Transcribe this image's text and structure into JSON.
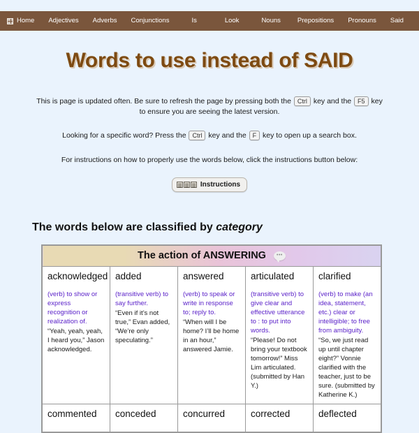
{
  "nav": {
    "items": [
      {
        "label": "Home",
        "icon": "home-icon"
      },
      {
        "label": "Adjectives"
      },
      {
        "label": "Adverbs"
      },
      {
        "label": "Conjunctions"
      },
      {
        "label": "Is"
      },
      {
        "label": "Look"
      },
      {
        "label": "Nouns"
      },
      {
        "label": "Prepositions"
      },
      {
        "label": "Pronouns"
      },
      {
        "label": "Said"
      }
    ],
    "bar_color": "#7a563c"
  },
  "header": {
    "title": "Words to use instead of SAID",
    "title_color": "#7d4a12"
  },
  "intro": {
    "p1_a": "This is page is updated often. Be sure to refresh the page by pressing both the",
    "p1_key1": "Ctrl",
    "p1_b": "key and the",
    "p1_key2": "F5",
    "p1_c": "key to ensure you are seeing the latest version.",
    "p2_a": "Looking for a specific word? Press the",
    "p2_key1": "Ctrl",
    "p2_b": "key and the",
    "p2_key2": "F",
    "p2_c": "key to open up a search box.",
    "p3": "For instructions on how to properly use the words below, click the instructions button below:"
  },
  "instructions_button": {
    "label": "Instructions",
    "icon": "document-grid-icon"
  },
  "section": {
    "heading_a": "The words below are classified by ",
    "heading_em": "category"
  },
  "table": {
    "category_title": "The action of ANSWERING",
    "category_icon": "speech-bubble-icon",
    "bubble_dots": "•••",
    "rows": [
      [
        {
          "word": "acknowledged",
          "definition": "(verb) to show or express recognition or realization of.",
          "example": "“Yeah, yeah, yeah, I heard you,” Jason acknowledged."
        },
        {
          "word": "added",
          "definition": "(transitive verb) to say further.",
          "example": "“Even if it’s not true,” Evan added, “We’re only speculating.”"
        },
        {
          "word": "answered",
          "definition": "(verb) to speak or write in response to; reply to.",
          "example": "“When will I be home? I’ll be home in an hour,” answered Jamie."
        },
        {
          "word": "articulated",
          "definition": "(transitive verb) to give clear and effective utterance to : to put into words.",
          "example": "“Please! Do not bring your textbook tomorrow!” Miss Lim articulated. (submitted by Han Y.)"
        },
        {
          "word": "clarified",
          "definition": "(verb) to make (an idea, statement, etc.) clear or intelligible; to free from ambiguity.",
          "example": "“So, we just read up until chapter eight?” Vonnie clarified with the teacher, just to be sure. (submitted by Katherine K.)"
        }
      ],
      [
        {
          "word": "commented"
        },
        {
          "word": "conceded"
        },
        {
          "word": "concurred"
        },
        {
          "word": "corrected"
        },
        {
          "word": "deflected"
        }
      ]
    ]
  }
}
